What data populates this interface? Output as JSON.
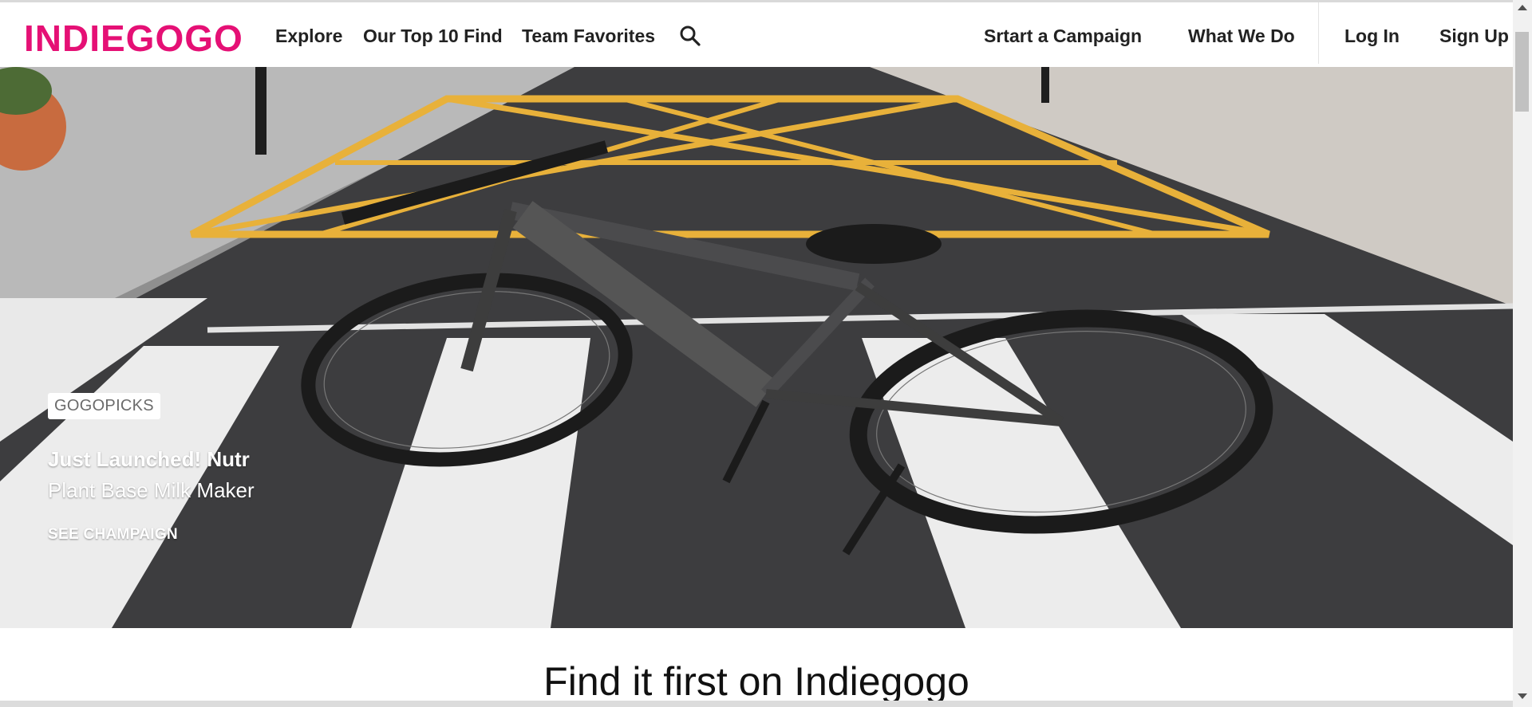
{
  "header": {
    "logo": "INDIEGOGO",
    "nav": {
      "explore": "Explore",
      "top10": "Our Top 10 Find",
      "team_favorites": "Team Favorites",
      "start_campaign": "Srtart a Campaign",
      "what_we_do": "What We Do",
      "log_in": "Log In",
      "sign_up": "Sign Up"
    },
    "search_icon": "search-icon"
  },
  "hero": {
    "badge": "GOGOPICKS",
    "title": "Just Launched! Nutr",
    "subtitle": "Plant Base Milk Maker",
    "cta": "SEE CHAMPAIGN"
  },
  "section": {
    "heading": "Find it first on Indiegogo"
  },
  "colors": {
    "brand": "#e51075",
    "road_line": "#e8b13a"
  }
}
